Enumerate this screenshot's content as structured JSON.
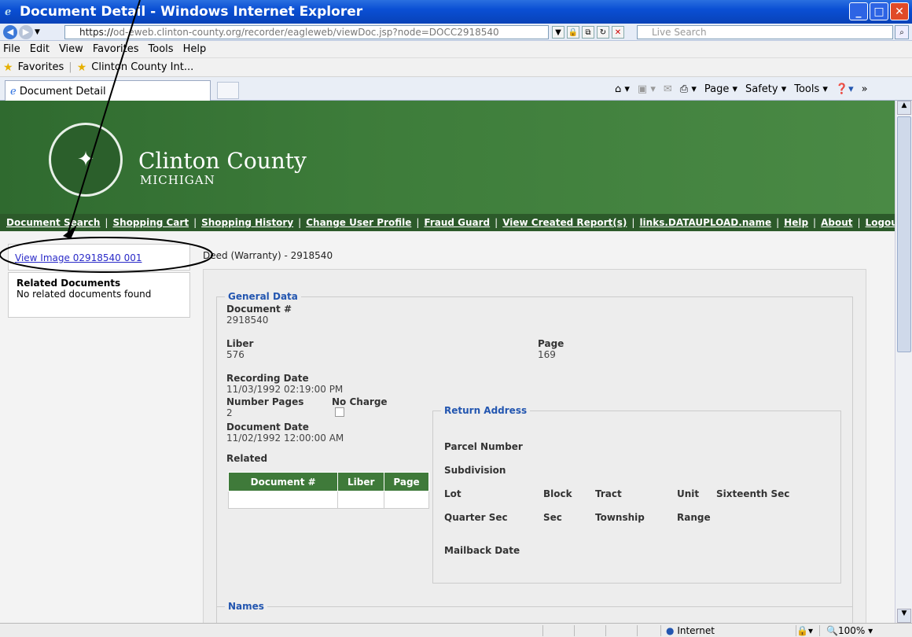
{
  "window": {
    "title": "Document Detail - Windows Internet Explorer"
  },
  "address": {
    "url_prefix": "https://",
    "url_host": "od-eweb.clinton-county.org",
    "url_path": "/recorder/eagleweb/viewDoc.jsp?node=DOCC2918540",
    "search_placeholder": "Live Search"
  },
  "menu": [
    "File",
    "Edit",
    "View",
    "Favorites",
    "Tools",
    "Help"
  ],
  "favorites": {
    "label": "Favorites",
    "item": "Clinton County Int..."
  },
  "tab": {
    "label": "Document Detail"
  },
  "commands": [
    "Page ▾",
    "Safety ▾",
    "Tools ▾"
  ],
  "banner": {
    "county": "Clinton County",
    "state": "MICHIGAN"
  },
  "nav": [
    "Document Search",
    "Shopping Cart",
    "Shopping History",
    "Change User Profile",
    "Fraud Guard",
    "View Created Report(s)",
    "links.DATAUPLOAD.name",
    "Help",
    "About",
    "Logout CCA"
  ],
  "left": {
    "view_image": "View Image 02918540 001",
    "related_title": "Related Documents",
    "related_empty": "No related documents found"
  },
  "document": {
    "title": "Deed (Warranty) - 2918540",
    "general_legend": "General Data",
    "doc_num_label": "Document #",
    "doc_num": "2918540",
    "liber_label": "Liber",
    "liber": "576",
    "page_label": "Page",
    "page": "169",
    "rec_date_label": "Recording Date",
    "rec_date": "11/03/1992 02:19:00 PM",
    "num_pages_label": "Number Pages",
    "num_pages": "2",
    "no_charge_label": "No Charge",
    "doc_date_label": "Document Date",
    "doc_date": "11/02/1992 12:00:00 AM",
    "related_label": "Related",
    "related_cols": [
      "Document #",
      "Liber",
      "Page"
    ],
    "return_legend": "Return Address",
    "parcel": "Parcel Number",
    "subdivision": "Subdivision",
    "lot": "Lot",
    "block": "Block",
    "tract": "Tract",
    "unit": "Unit",
    "sixteenth": "Sixteenth Sec",
    "quarter": "Quarter Sec",
    "sec": "Sec",
    "township": "Township",
    "range": "Range",
    "mailback": "Mailback Date",
    "names_legend": "Names"
  },
  "status": {
    "zone": "Internet",
    "zoom": "100%"
  }
}
